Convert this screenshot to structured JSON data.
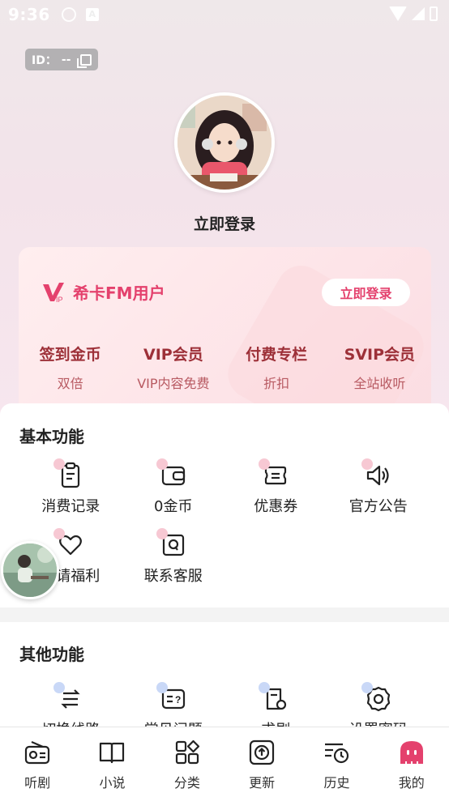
{
  "status_bar": {
    "time": "9:36"
  },
  "profile": {
    "id_label": "ID：",
    "id_value": "--",
    "login_text": "立即登录"
  },
  "vip_card": {
    "title": "希卡FM用户",
    "login_button": "立即登录",
    "benefits": [
      {
        "title": "签到金币",
        "sub": "双倍"
      },
      {
        "title": "VIP会员",
        "sub": "VIP内容免费"
      },
      {
        "title": "付费专栏",
        "sub": "折扣"
      },
      {
        "title": "SVIP会员",
        "sub": "全站收听"
      }
    ]
  },
  "basic_functions": {
    "title": "基本功能",
    "items": [
      {
        "label": "消费记录",
        "icon": "clipboard-icon"
      },
      {
        "label": "0金币",
        "icon": "wallet-icon"
      },
      {
        "label": "优惠券",
        "icon": "coupon-icon"
      },
      {
        "label": "官方公告",
        "icon": "speaker-icon"
      },
      {
        "label": "邀请福利",
        "icon": "heart-icon"
      },
      {
        "label": "联系客服",
        "icon": "support-icon"
      }
    ]
  },
  "other_functions": {
    "title": "其他功能",
    "items": [
      {
        "label": "切换线路",
        "icon": "switch-icon"
      },
      {
        "label": "常见问题",
        "icon": "faq-icon"
      },
      {
        "label": "求剧",
        "icon": "request-icon"
      },
      {
        "label": "设置密码",
        "icon": "gear-icon"
      }
    ]
  },
  "bottom_nav": [
    {
      "label": "听剧",
      "icon": "radio-icon"
    },
    {
      "label": "小说",
      "icon": "book-icon"
    },
    {
      "label": "分类",
      "icon": "category-icon"
    },
    {
      "label": "更新",
      "icon": "update-icon"
    },
    {
      "label": "历史",
      "icon": "history-icon"
    },
    {
      "label": "我的",
      "icon": "mine-icon",
      "active": true
    }
  ],
  "colors": {
    "accent": "#e4416d",
    "benefit_title": "#9d3038",
    "icon_dot_pink": "#f7c8d3",
    "icon_dot_blue": "#c9d8f7"
  }
}
